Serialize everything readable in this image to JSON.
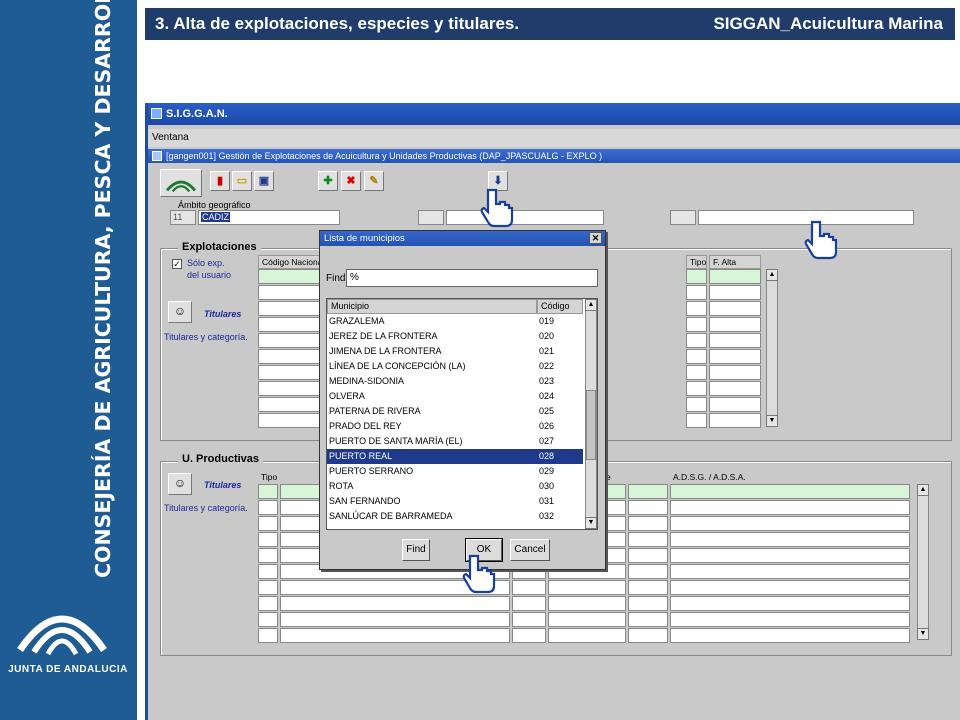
{
  "slide": {
    "title_left": "3. Alta de explotaciones, especies y titulares.",
    "title_right": "SIGGAN_Acuicultura Marina"
  },
  "brand": {
    "vertical_text": "CONSEJERÍA DE AGRICULTURA, PESCA Y DESARROLLO RURAL",
    "logo_text": "JUNTA DE ANDALUCIA",
    "color": "#1f5c93"
  },
  "app": {
    "window_title": "S.I.G.G.A.N.",
    "menu": "Ventana",
    "inner_title": "[gangen001] Gestión de Explotaciones de Acuicultura y Unidades Productivas (DAP_JPASCUALG - EXPLO )",
    "ambito": {
      "label": "Ámbito geográfico",
      "code": "11",
      "name": "CADIZ"
    },
    "explotaciones": {
      "title": "Explotaciones",
      "solo_exp": "Sólo exp.",
      "del_usuario": "del usuario",
      "titulares_btn": "Titulares",
      "titulares_cat": "Titulares y categoría.",
      "col_codigo": "Código Nacional",
      "col_tipo": "Tipo",
      "col_falta": "F. Alta"
    },
    "uproductivas": {
      "title": "U. Productivas",
      "col_tipo": "Tipo",
      "col_e": "e",
      "col_adsg": "A.D.S.G. / A.D.S.A.",
      "titulares_btn": "Titulares",
      "titulares_cat": "Titulares y categoría."
    }
  },
  "dialog": {
    "title": "Lista de municipios",
    "find_label": "Find",
    "find_value": "%",
    "col_municipio": "Municipio",
    "col_codigo": "Código",
    "rows": [
      {
        "municipio": "GRAZALEMA",
        "codigo": "019"
      },
      {
        "municipio": "JEREZ DE LA FRONTERA",
        "codigo": "020"
      },
      {
        "municipio": "JIMENA DE LA FRONTERA",
        "codigo": "021"
      },
      {
        "municipio": "LÍNEA DE LA CONCEPCIÓN (LA)",
        "codigo": "022"
      },
      {
        "municipio": "MEDINA-SIDONIA",
        "codigo": "023"
      },
      {
        "municipio": "OLVERA",
        "codigo": "024"
      },
      {
        "municipio": "PATERNA DE RIVERA",
        "codigo": "025"
      },
      {
        "municipio": "PRADO DEL REY",
        "codigo": "026"
      },
      {
        "municipio": "PUERTO DE SANTA MARÍA (EL)",
        "codigo": "027"
      },
      {
        "municipio": "PUERTO REAL",
        "codigo": "028"
      },
      {
        "municipio": "PUERTO SERRANO",
        "codigo": "029"
      },
      {
        "municipio": "ROTA",
        "codigo": "030"
      },
      {
        "municipio": "SAN FERNANDO",
        "codigo": "031"
      },
      {
        "municipio": "SANLÚCAR DE BARRAMEDA",
        "codigo": "032"
      }
    ],
    "selected_codigo": "028",
    "btn_find": "Find",
    "btn_ok": "OK",
    "btn_cancel": "Cancel"
  }
}
